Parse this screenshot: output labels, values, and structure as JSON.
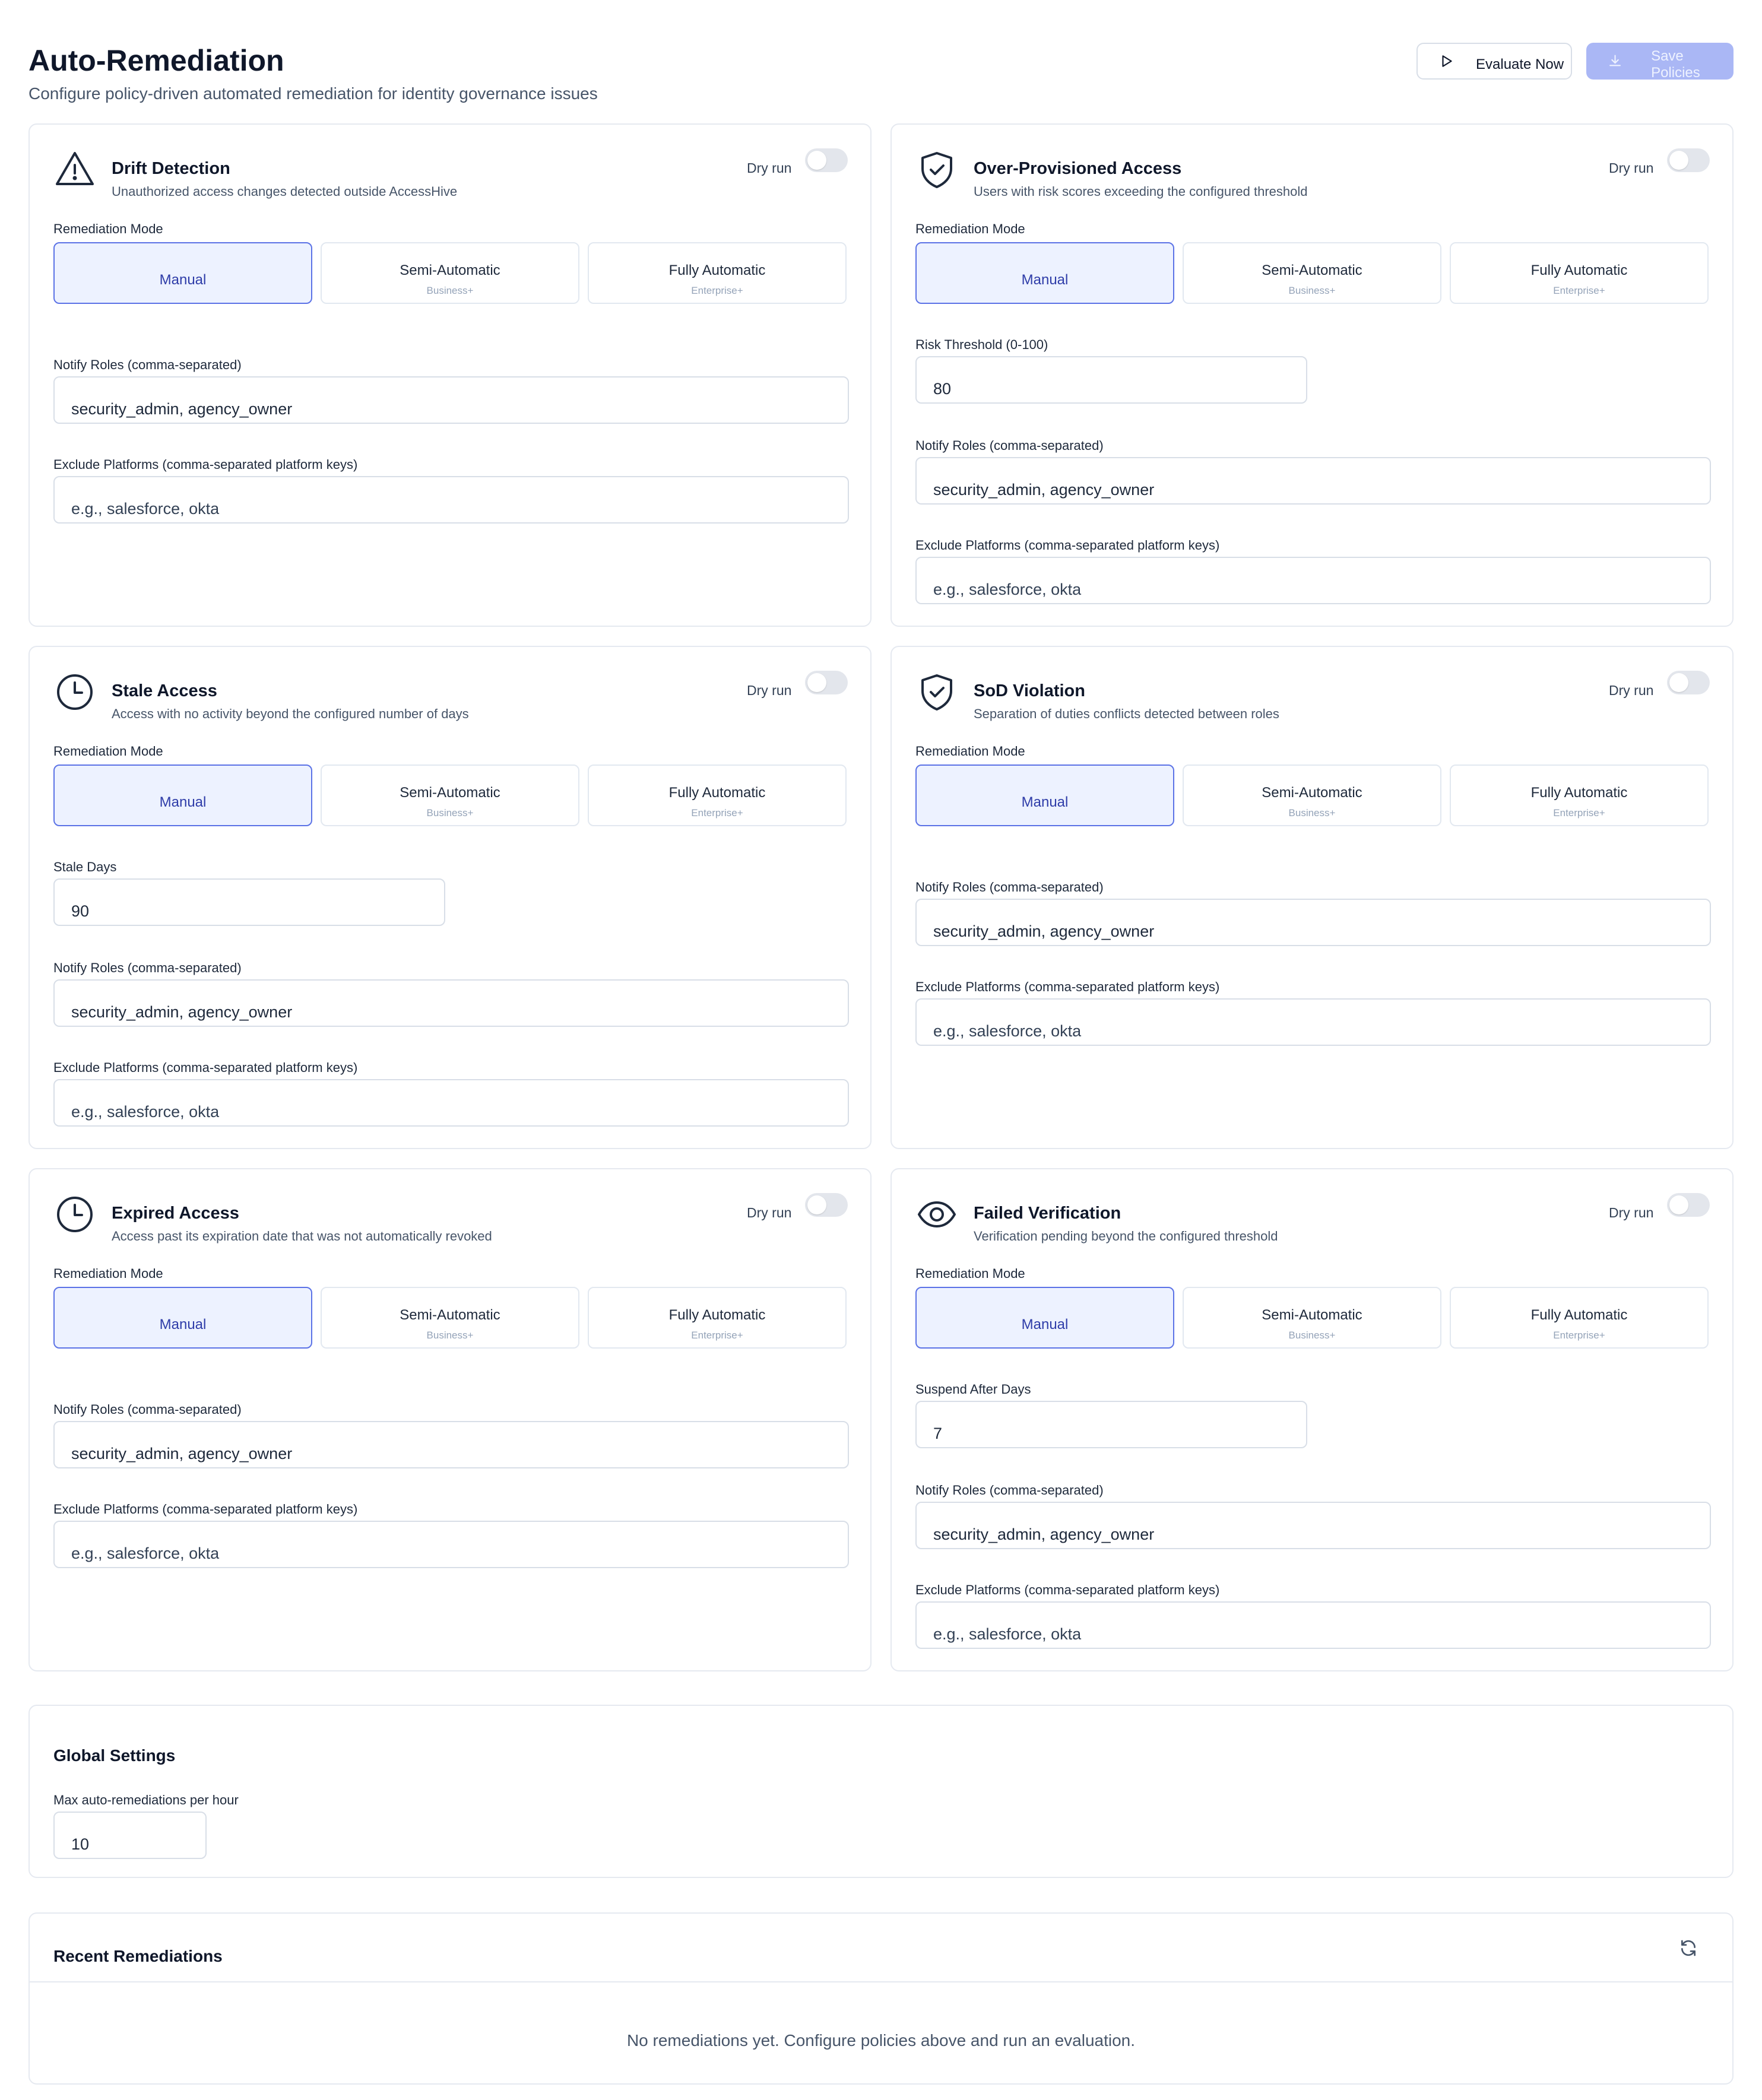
{
  "header": {
    "title": "Auto-Remediation",
    "subtitle": "Configure policy-driven automated remediation for identity governance issues",
    "evaluate_label": "Evaluate Now",
    "save_label": "Save Policies"
  },
  "common": {
    "dry_run": "Dry run",
    "mode_label": "Remediation Mode",
    "modes": [
      {
        "name": "Manual",
        "tier": ""
      },
      {
        "name": "Semi-Automatic",
        "tier": "Business+"
      },
      {
        "name": "Fully Automatic",
        "tier": "Enterprise+"
      }
    ],
    "notify_label": "Notify Roles (comma-separated)",
    "notify_value": "security_admin, agency_owner",
    "exclude_label": "Exclude Platforms (comma-separated platform keys)",
    "exclude_placeholder": "e.g., salesforce, okta"
  },
  "policies": [
    {
      "title": "Drift Detection",
      "desc": "Unauthorized access changes detected outside AccessHive",
      "icon": "warning-icon",
      "dry_run": false,
      "selected_mode": "Manual"
    },
    {
      "title": "Over-Provisioned Access",
      "desc": "Users with risk scores exceeding the configured threshold",
      "icon": "shield-check-icon",
      "dry_run": false,
      "selected_mode": "Manual",
      "extra_label": "Risk Threshold (0-100)",
      "extra_value": "80"
    },
    {
      "title": "Stale Access",
      "desc": "Access with no activity beyond the configured number of days",
      "icon": "clock-icon",
      "dry_run": false,
      "selected_mode": "Manual",
      "extra_label": "Stale Days",
      "extra_value": "90"
    },
    {
      "title": "SoD Violation",
      "desc": "Separation of duties conflicts detected between roles",
      "icon": "shield-check-icon",
      "dry_run": false,
      "selected_mode": "Manual"
    },
    {
      "title": "Expired Access",
      "desc": "Access past its expiration date that was not automatically revoked",
      "icon": "clock-icon",
      "dry_run": false,
      "selected_mode": "Manual"
    },
    {
      "title": "Failed Verification",
      "desc": "Verification pending beyond the configured threshold",
      "icon": "eye-icon",
      "dry_run": false,
      "selected_mode": "Manual",
      "extra_label": "Suspend After Days",
      "extra_value": "7"
    }
  ],
  "global": {
    "title": "Global Settings",
    "max_label": "Max auto-remediations per hour",
    "max_value": "10"
  },
  "recent": {
    "title": "Recent Remediations",
    "empty": "No remediations yet. Configure policies above and run an evaluation."
  }
}
